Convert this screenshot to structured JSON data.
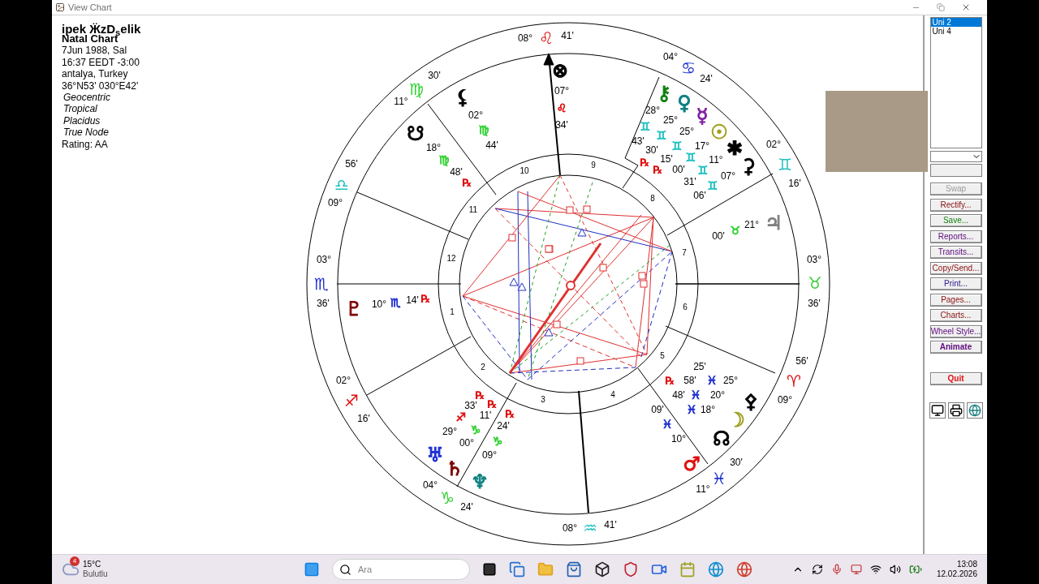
{
  "window": {
    "title": "View Chart"
  },
  "info": {
    "name": "ipek ӜzD$_{s}$elik",
    "lines": [
      {
        "text": "Natal Chart",
        "kind": "heading"
      },
      {
        "text": "7Jun 1988, Sal",
        "kind": "detail"
      },
      {
        "text": "16:37 EEDT -3:00",
        "kind": "detail"
      },
      {
        "text": "antalya, Turkey",
        "kind": "detail"
      },
      {
        "text": "36°N53' 030°E42'",
        "kind": "detail"
      },
      {
        "text": "Geocentric",
        "kind": "setting"
      },
      {
        "text": "Tropical",
        "kind": "setting"
      },
      {
        "text": "Placidus",
        "kind": "setting"
      },
      {
        "text": "True Node",
        "kind": "setting"
      },
      {
        "text": "Rating: AA",
        "kind": "detail"
      }
    ]
  },
  "chart": {
    "houses": [
      "9",
      "10",
      "11",
      "12",
      "1",
      "2",
      "3",
      "4",
      "5",
      "6",
      "7",
      "8"
    ],
    "labels": [
      {
        "text": "08°",
        "kind": "deg"
      },
      {
        "text": "♌",
        "kind": "sign",
        "color": "#e01010"
      },
      {
        "text": "41'",
        "kind": "deg"
      },
      {
        "text": "⊗",
        "kind": "planet",
        "color": "#000000"
      },
      {
        "text": "07°",
        "kind": "deg"
      },
      {
        "text": "♌",
        "kind": "small",
        "color": "#e01010"
      },
      {
        "text": "34'",
        "kind": "deg"
      },
      {
        "text": "04°",
        "kind": "deg"
      },
      {
        "text": "♋",
        "kind": "sign",
        "color": "#1f2fd0"
      },
      {
        "text": "24'",
        "kind": "deg"
      },
      {
        "text": "⚷",
        "kind": "planet",
        "color": "#108010"
      },
      {
        "text": "♀",
        "kind": "planet",
        "color": "#108080"
      },
      {
        "text": "☿",
        "kind": "planet",
        "color": "#8020a0"
      },
      {
        "text": "☉",
        "kind": "planet",
        "color": "#a0a020"
      },
      {
        "text": "✱",
        "kind": "planet",
        "color": "#000000"
      },
      {
        "text": "⚳",
        "kind": "planet",
        "color": "#000000"
      },
      {
        "text": "28°",
        "kind": "deg"
      },
      {
        "text": "25°",
        "kind": "deg"
      },
      {
        "text": "25°",
        "kind": "deg"
      },
      {
        "text": "17°",
        "kind": "deg"
      },
      {
        "text": "11°",
        "kind": "deg"
      },
      {
        "text": "07°",
        "kind": "deg"
      },
      {
        "text": "♊",
        "kind": "small",
        "color": "#20c0c0"
      },
      {
        "text": "♊",
        "kind": "small",
        "color": "#20c0c0"
      },
      {
        "text": "♊",
        "kind": "small",
        "color": "#20c0c0"
      },
      {
        "text": "♊",
        "kind": "small",
        "color": "#20c0c0"
      },
      {
        "text": "♊",
        "kind": "small",
        "color": "#20c0c0"
      },
      {
        "text": "♊",
        "kind": "small",
        "color": "#20c0c0"
      },
      {
        "text": "43'",
        "kind": "deg"
      },
      {
        "text": "30'",
        "kind": "deg"
      },
      {
        "text": "15'",
        "kind": "deg"
      },
      {
        "text": "00'",
        "kind": "deg"
      },
      {
        "text": "31'",
        "kind": "deg"
      },
      {
        "text": "06'",
        "kind": "deg"
      },
      {
        "text": "℞",
        "kind": "retro",
        "color": "#e01010"
      },
      {
        "text": "℞",
        "kind": "retro",
        "color": "#e01010"
      },
      {
        "text": "02°",
        "kind": "deg"
      },
      {
        "text": "♊",
        "kind": "sign",
        "color": "#20c0c0"
      },
      {
        "text": "16'",
        "kind": "deg"
      },
      {
        "text": "00'",
        "kind": "deg"
      },
      {
        "text": "♉",
        "kind": "small",
        "color": "#30d030"
      },
      {
        "text": "21°",
        "kind": "deg"
      },
      {
        "text": "♃",
        "kind": "planet",
        "color": "#808080"
      },
      {
        "text": "03°",
        "kind": "deg"
      },
      {
        "text": "♉",
        "kind": "sign",
        "color": "#30d030"
      },
      {
        "text": "36'",
        "kind": "deg"
      },
      {
        "text": "03°",
        "kind": "deg"
      },
      {
        "text": "♏",
        "kind": "sign",
        "color": "#1f2fd0"
      },
      {
        "text": "36'",
        "kind": "deg"
      },
      {
        "text": "56'",
        "kind": "deg"
      },
      {
        "text": "♎",
        "kind": "sign",
        "color": "#20c0c0"
      },
      {
        "text": "09°",
        "kind": "deg"
      },
      {
        "text": "11°",
        "kind": "deg"
      },
      {
        "text": "♍",
        "kind": "sign",
        "color": "#30d030"
      },
      {
        "text": "30'",
        "kind": "deg"
      },
      {
        "text": "⚸",
        "kind": "planet",
        "color": "#000000"
      },
      {
        "text": "02°",
        "kind": "deg"
      },
      {
        "text": "♍",
        "kind": "small",
        "color": "#30d030"
      },
      {
        "text": "44'",
        "kind": "deg"
      },
      {
        "text": "☋",
        "kind": "planet",
        "color": "#000000"
      },
      {
        "text": "18°",
        "kind": "deg"
      },
      {
        "text": "♍",
        "kind": "small",
        "color": "#30d030"
      },
      {
        "text": "48'",
        "kind": "deg"
      },
      {
        "text": "℞",
        "kind": "retro",
        "color": "#e01010"
      },
      {
        "text": "♇",
        "kind": "planet",
        "color": "#800000"
      },
      {
        "text": "10°",
        "kind": "deg"
      },
      {
        "text": "♏",
        "kind": "small",
        "color": "#1f2fd0"
      },
      {
        "text": "14'",
        "kind": "deg"
      },
      {
        "text": "℞",
        "kind": "retro",
        "color": "#e01010"
      },
      {
        "text": "02°",
        "kind": "deg"
      },
      {
        "text": "♐",
        "kind": "sign",
        "color": "#e01010"
      },
      {
        "text": "16'",
        "kind": "deg"
      },
      {
        "text": "℞",
        "kind": "retro",
        "color": "#e01010"
      },
      {
        "text": "℞",
        "kind": "retro",
        "color": "#e01010"
      },
      {
        "text": "℞",
        "kind": "retro",
        "color": "#e01010"
      },
      {
        "text": "33'",
        "kind": "deg"
      },
      {
        "text": "11'",
        "kind": "deg"
      },
      {
        "text": "24'",
        "kind": "deg"
      },
      {
        "text": "♐",
        "kind": "small",
        "color": "#e01010"
      },
      {
        "text": "29°",
        "kind": "deg"
      },
      {
        "text": "♑",
        "kind": "small",
        "color": "#30d030"
      },
      {
        "text": "00°",
        "kind": "deg"
      },
      {
        "text": "♑",
        "kind": "small",
        "color": "#30d030"
      },
      {
        "text": "09°",
        "kind": "deg"
      },
      {
        "text": "♅",
        "kind": "planet",
        "color": "#1f2fd0"
      },
      {
        "text": "♄",
        "kind": "planet",
        "color": "#800000"
      },
      {
        "text": "04°",
        "kind": "deg"
      },
      {
        "text": "♆",
        "kind": "planet",
        "color": "#108080"
      },
      {
        "text": "♑",
        "kind": "sign",
        "color": "#30d030"
      },
      {
        "text": "24'",
        "kind": "deg"
      },
      {
        "text": "08°",
        "kind": "deg"
      },
      {
        "text": "♒",
        "kind": "sign",
        "color": "#20c0c0"
      },
      {
        "text": "41'",
        "kind": "deg"
      },
      {
        "text": "25'",
        "kind": "deg"
      },
      {
        "text": "℞",
        "kind": "retro",
        "color": "#e01010"
      },
      {
        "text": "58'",
        "kind": "deg"
      },
      {
        "text": "♓",
        "kind": "small",
        "color": "#1f2fd0"
      },
      {
        "text": "25°",
        "kind": "deg"
      },
      {
        "text": "48'",
        "kind": "deg"
      },
      {
        "text": "♓",
        "kind": "small",
        "color": "#1f2fd0"
      },
      {
        "text": "20°",
        "kind": "deg"
      },
      {
        "text": "09'",
        "kind": "deg"
      },
      {
        "text": "♓",
        "kind": "small",
        "color": "#1f2fd0"
      },
      {
        "text": "18°",
        "kind": "deg"
      },
      {
        "text": "♓",
        "kind": "small",
        "color": "#1f2fd0"
      },
      {
        "text": "10°",
        "kind": "deg"
      },
      {
        "text": "⚴",
        "kind": "planet",
        "color": "#000000"
      },
      {
        "text": "☽",
        "kind": "planet",
        "color": "#a0a020"
      },
      {
        "text": "☊",
        "kind": "planet",
        "color": "#000000"
      },
      {
        "text": "♂",
        "kind": "planet",
        "color": "#e01010"
      },
      {
        "text": "30'",
        "kind": "deg"
      },
      {
        "text": "♓",
        "kind": "sign",
        "color": "#1f2fd0"
      },
      {
        "text": "11°",
        "kind": "deg"
      },
      {
        "text": "56'",
        "kind": "deg"
      },
      {
        "text": "♈",
        "kind": "sign",
        "color": "#e01010"
      },
      {
        "text": "09°",
        "kind": "deg"
      }
    ]
  },
  "chart_list": {
    "items": [
      {
        "label": "Uni 2",
        "selected": true
      },
      {
        "label": "Uni 4",
        "selected": false
      }
    ]
  },
  "buttons": [
    {
      "label": "Swap",
      "disabled": true,
      "bold": false
    },
    {
      "label": "Rectify...",
      "disabled": false,
      "bold": false
    },
    {
      "label": "Save...",
      "disabled": false,
      "bold": false
    },
    {
      "label": "Reports...",
      "disabled": false,
      "bold": false
    },
    {
      "label": "Transits...",
      "disabled": false,
      "bold": false
    },
    {
      "label": "Copy/Send...",
      "disabled": false,
      "bold": false
    },
    {
      "label": "Print...",
      "disabled": false,
      "bold": false
    },
    {
      "label": "Pages...",
      "disabled": false,
      "bold": false
    },
    {
      "label": "Charts...",
      "disabled": false,
      "bold": false
    },
    {
      "label": "Wheel Style...",
      "disabled": false,
      "bold": false
    },
    {
      "label": "Animate",
      "disabled": false,
      "bold": true
    },
    {
      "label": "Quit",
      "disabled": false,
      "bold": true
    }
  ],
  "taskbar": {
    "weather": {
      "badge": "4",
      "temperature": "15°C",
      "condition": "Bulutlu"
    },
    "search": {
      "placeholder": "Ara"
    },
    "time": "13:08",
    "date": "12.02.2026"
  }
}
